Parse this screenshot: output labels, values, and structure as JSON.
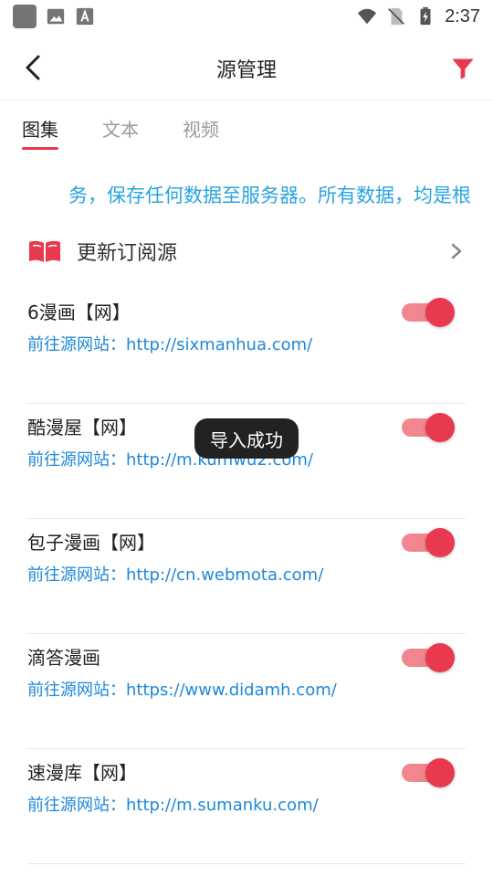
{
  "status_bar": {
    "time": "2:37"
  },
  "app_bar": {
    "title": "源管理"
  },
  "tabs": [
    {
      "label": "图集",
      "active": true
    },
    {
      "label": "文本",
      "active": false
    },
    {
      "label": "视频",
      "active": false
    }
  ],
  "notice": {
    "text": "务，保存任何数据至服务器。所有数据，均是根"
  },
  "update_row": {
    "label": "更新订阅源"
  },
  "sources": [
    {
      "name": "6漫画【网】",
      "link": "前往源网站：http://sixmanhua.com/",
      "enabled": true
    },
    {
      "name": "酷漫屋【网】",
      "link": "前往源网站：http://m.kumwu2.com/",
      "enabled": true
    },
    {
      "name": "包子漫画【网】",
      "link": "前往源网站：http://cn.webmota.com/",
      "enabled": true
    },
    {
      "name": "滴答漫画",
      "link": "前往源网站：https://www.didamh.com/",
      "enabled": true
    },
    {
      "name": "速漫库【网】",
      "link": "前往源网站：http://m.sumanku.com/",
      "enabled": true
    }
  ],
  "toast": {
    "text": "导入成功"
  },
  "colors": {
    "accent": "#e8394e",
    "link": "#1e88d8",
    "notice": "#29a4e0"
  }
}
